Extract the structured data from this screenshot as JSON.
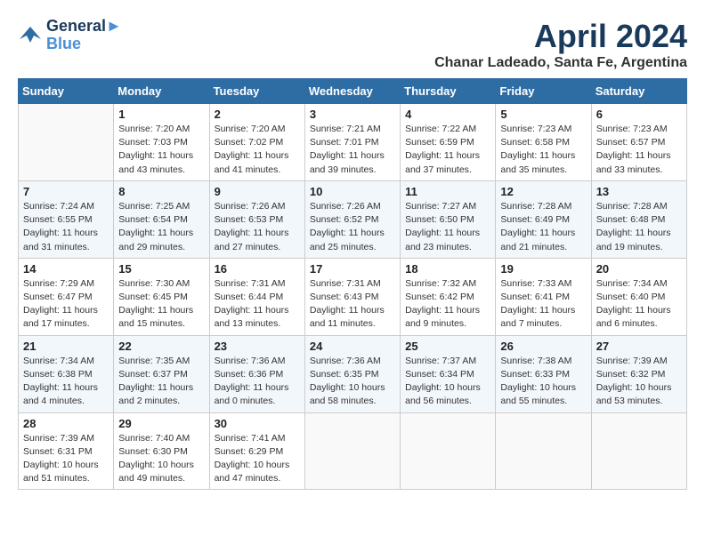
{
  "logo": {
    "line1": "General",
    "line2": "Blue"
  },
  "title": "April 2024",
  "location": "Chanar Ladeado, Santa Fe, Argentina",
  "weekdays": [
    "Sunday",
    "Monday",
    "Tuesday",
    "Wednesday",
    "Thursday",
    "Friday",
    "Saturday"
  ],
  "weeks": [
    [
      {
        "day": "",
        "sunrise": "",
        "sunset": "",
        "daylight": ""
      },
      {
        "day": "1",
        "sunrise": "Sunrise: 7:20 AM",
        "sunset": "Sunset: 7:03 PM",
        "daylight": "Daylight: 11 hours and 43 minutes."
      },
      {
        "day": "2",
        "sunrise": "Sunrise: 7:20 AM",
        "sunset": "Sunset: 7:02 PM",
        "daylight": "Daylight: 11 hours and 41 minutes."
      },
      {
        "day": "3",
        "sunrise": "Sunrise: 7:21 AM",
        "sunset": "Sunset: 7:01 PM",
        "daylight": "Daylight: 11 hours and 39 minutes."
      },
      {
        "day": "4",
        "sunrise": "Sunrise: 7:22 AM",
        "sunset": "Sunset: 6:59 PM",
        "daylight": "Daylight: 11 hours and 37 minutes."
      },
      {
        "day": "5",
        "sunrise": "Sunrise: 7:23 AM",
        "sunset": "Sunset: 6:58 PM",
        "daylight": "Daylight: 11 hours and 35 minutes."
      },
      {
        "day": "6",
        "sunrise": "Sunrise: 7:23 AM",
        "sunset": "Sunset: 6:57 PM",
        "daylight": "Daylight: 11 hours and 33 minutes."
      }
    ],
    [
      {
        "day": "7",
        "sunrise": "Sunrise: 7:24 AM",
        "sunset": "Sunset: 6:55 PM",
        "daylight": "Daylight: 11 hours and 31 minutes."
      },
      {
        "day": "8",
        "sunrise": "Sunrise: 7:25 AM",
        "sunset": "Sunset: 6:54 PM",
        "daylight": "Daylight: 11 hours and 29 minutes."
      },
      {
        "day": "9",
        "sunrise": "Sunrise: 7:26 AM",
        "sunset": "Sunset: 6:53 PM",
        "daylight": "Daylight: 11 hours and 27 minutes."
      },
      {
        "day": "10",
        "sunrise": "Sunrise: 7:26 AM",
        "sunset": "Sunset: 6:52 PM",
        "daylight": "Daylight: 11 hours and 25 minutes."
      },
      {
        "day": "11",
        "sunrise": "Sunrise: 7:27 AM",
        "sunset": "Sunset: 6:50 PM",
        "daylight": "Daylight: 11 hours and 23 minutes."
      },
      {
        "day": "12",
        "sunrise": "Sunrise: 7:28 AM",
        "sunset": "Sunset: 6:49 PM",
        "daylight": "Daylight: 11 hours and 21 minutes."
      },
      {
        "day": "13",
        "sunrise": "Sunrise: 7:28 AM",
        "sunset": "Sunset: 6:48 PM",
        "daylight": "Daylight: 11 hours and 19 minutes."
      }
    ],
    [
      {
        "day": "14",
        "sunrise": "Sunrise: 7:29 AM",
        "sunset": "Sunset: 6:47 PM",
        "daylight": "Daylight: 11 hours and 17 minutes."
      },
      {
        "day": "15",
        "sunrise": "Sunrise: 7:30 AM",
        "sunset": "Sunset: 6:45 PM",
        "daylight": "Daylight: 11 hours and 15 minutes."
      },
      {
        "day": "16",
        "sunrise": "Sunrise: 7:31 AM",
        "sunset": "Sunset: 6:44 PM",
        "daylight": "Daylight: 11 hours and 13 minutes."
      },
      {
        "day": "17",
        "sunrise": "Sunrise: 7:31 AM",
        "sunset": "Sunset: 6:43 PM",
        "daylight": "Daylight: 11 hours and 11 minutes."
      },
      {
        "day": "18",
        "sunrise": "Sunrise: 7:32 AM",
        "sunset": "Sunset: 6:42 PM",
        "daylight": "Daylight: 11 hours and 9 minutes."
      },
      {
        "day": "19",
        "sunrise": "Sunrise: 7:33 AM",
        "sunset": "Sunset: 6:41 PM",
        "daylight": "Daylight: 11 hours and 7 minutes."
      },
      {
        "day": "20",
        "sunrise": "Sunrise: 7:34 AM",
        "sunset": "Sunset: 6:40 PM",
        "daylight": "Daylight: 11 hours and 6 minutes."
      }
    ],
    [
      {
        "day": "21",
        "sunrise": "Sunrise: 7:34 AM",
        "sunset": "Sunset: 6:38 PM",
        "daylight": "Daylight: 11 hours and 4 minutes."
      },
      {
        "day": "22",
        "sunrise": "Sunrise: 7:35 AM",
        "sunset": "Sunset: 6:37 PM",
        "daylight": "Daylight: 11 hours and 2 minutes."
      },
      {
        "day": "23",
        "sunrise": "Sunrise: 7:36 AM",
        "sunset": "Sunset: 6:36 PM",
        "daylight": "Daylight: 11 hours and 0 minutes."
      },
      {
        "day": "24",
        "sunrise": "Sunrise: 7:36 AM",
        "sunset": "Sunset: 6:35 PM",
        "daylight": "Daylight: 10 hours and 58 minutes."
      },
      {
        "day": "25",
        "sunrise": "Sunrise: 7:37 AM",
        "sunset": "Sunset: 6:34 PM",
        "daylight": "Daylight: 10 hours and 56 minutes."
      },
      {
        "day": "26",
        "sunrise": "Sunrise: 7:38 AM",
        "sunset": "Sunset: 6:33 PM",
        "daylight": "Daylight: 10 hours and 55 minutes."
      },
      {
        "day": "27",
        "sunrise": "Sunrise: 7:39 AM",
        "sunset": "Sunset: 6:32 PM",
        "daylight": "Daylight: 10 hours and 53 minutes."
      }
    ],
    [
      {
        "day": "28",
        "sunrise": "Sunrise: 7:39 AM",
        "sunset": "Sunset: 6:31 PM",
        "daylight": "Daylight: 10 hours and 51 minutes."
      },
      {
        "day": "29",
        "sunrise": "Sunrise: 7:40 AM",
        "sunset": "Sunset: 6:30 PM",
        "daylight": "Daylight: 10 hours and 49 minutes."
      },
      {
        "day": "30",
        "sunrise": "Sunrise: 7:41 AM",
        "sunset": "Sunset: 6:29 PM",
        "daylight": "Daylight: 10 hours and 47 minutes."
      },
      {
        "day": "",
        "sunrise": "",
        "sunset": "",
        "daylight": ""
      },
      {
        "day": "",
        "sunrise": "",
        "sunset": "",
        "daylight": ""
      },
      {
        "day": "",
        "sunrise": "",
        "sunset": "",
        "daylight": ""
      },
      {
        "day": "",
        "sunrise": "",
        "sunset": "",
        "daylight": ""
      }
    ]
  ]
}
